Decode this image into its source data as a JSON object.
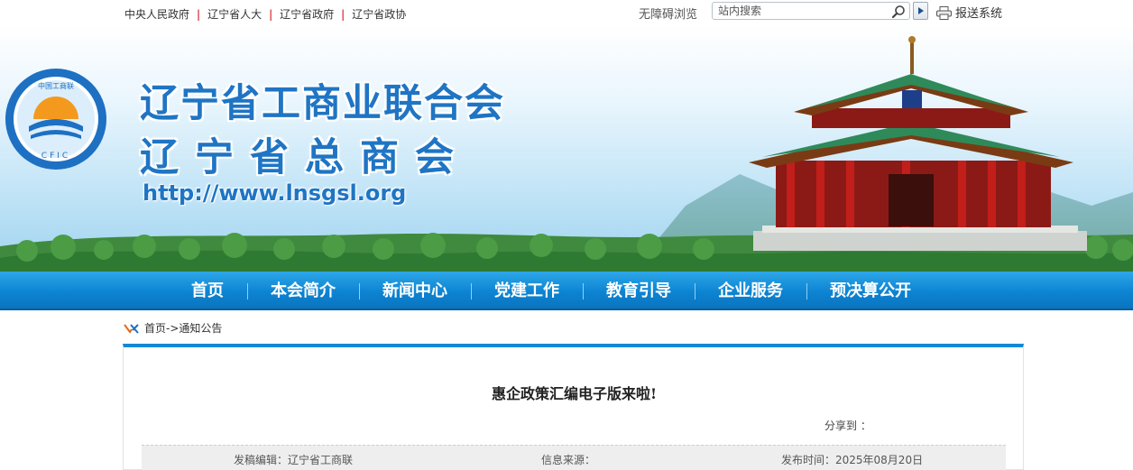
{
  "topbar": {
    "links": [
      "中央人民政府",
      "辽宁省人大",
      "辽宁省政府",
      "辽宁省政协"
    ],
    "accessibility": "无障碍浏览",
    "search_placeholder": "站内搜索",
    "report": "报送系统"
  },
  "banner": {
    "title_line1": "辽宁省工商业联合会",
    "title_line2": "辽宁省总商会",
    "url": "http://www.lnsgsl.org",
    "emblem_text_top": "中国工商联",
    "emblem_text_bottom": "CFIC"
  },
  "nav": {
    "items": [
      "首页",
      "本会简介",
      "新闻中心",
      "党建工作",
      "教育引导",
      "企业服务",
      "预决算公开"
    ]
  },
  "breadcrumb": {
    "home": "首页",
    "arrow": "->",
    "current": "通知公告"
  },
  "article": {
    "title": "惠企政策汇编电子版来啦!",
    "share": "分享到 ：",
    "editor": "发稿编辑：辽宁省工商联",
    "source": "信息来源：",
    "date": "发布时间：2025年08月20日"
  },
  "colors": {
    "brand_blue": "#1f75c4",
    "nav_blue": "#0d84d2",
    "accent_red": "#cc0000"
  }
}
